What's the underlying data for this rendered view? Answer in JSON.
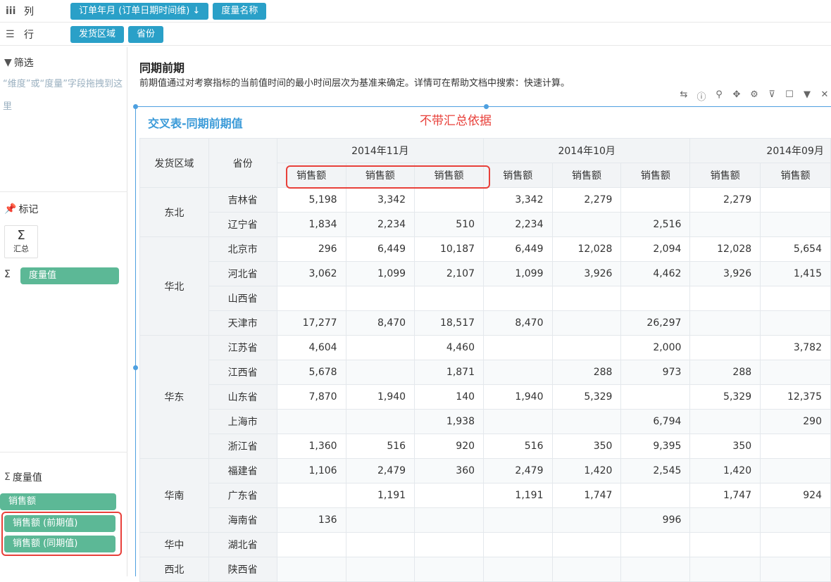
{
  "shelves": {
    "columns": {
      "label": "列",
      "pills": [
        "订单年月 (订单日期时间维) ↓",
        "度量名称"
      ]
    },
    "rows": {
      "label": "行",
      "pills": [
        "发货区域",
        "省份"
      ]
    }
  },
  "left": {
    "filter_title": "筛选",
    "filter_hint": "“维度”或“度量”字段拖拽到这里",
    "marks_title": "标记",
    "sum_label": "汇总",
    "measure_value_pill": "度量值",
    "measures_title": "度量值",
    "measures": [
      "销售额",
      "销售额 (前期值)",
      "销售额 (同期值)"
    ]
  },
  "main": {
    "title": "同期前期",
    "description": "前期值通过对考察指标的当前值时间的最小时间层次为基准来确定。详情可在帮助文档中搜索：快速计算。",
    "chart_title": "交叉表-同期前期值",
    "annotation": "不带汇总依据"
  },
  "table": {
    "row_headers": [
      "发货区域",
      "省份"
    ],
    "months": [
      "2014年11月",
      "2014年10月",
      "2014年09月"
    ],
    "measure_header": "销售额",
    "groups": [
      {
        "region": "东北",
        "rows": [
          {
            "province": "吉林省",
            "values": [
              "5,198",
              "3,342",
              "",
              "3,342",
              "2,279",
              "",
              "2,279",
              ""
            ]
          },
          {
            "province": "辽宁省",
            "values": [
              "1,834",
              "2,234",
              "510",
              "2,234",
              "",
              "2,516",
              "",
              ""
            ]
          }
        ]
      },
      {
        "region": "华北",
        "rows": [
          {
            "province": "北京市",
            "values": [
              "296",
              "6,449",
              "10,187",
              "6,449",
              "12,028",
              "2,094",
              "12,028",
              "5,654"
            ]
          },
          {
            "province": "河北省",
            "values": [
              "3,062",
              "1,099",
              "2,107",
              "1,099",
              "3,926",
              "4,462",
              "3,926",
              "1,415"
            ]
          },
          {
            "province": "山西省",
            "values": [
              "",
              "",
              "",
              "",
              "",
              "",
              "",
              ""
            ]
          },
          {
            "province": "天津市",
            "values": [
              "17,277",
              "8,470",
              "18,517",
              "8,470",
              "",
              "26,297",
              "",
              ""
            ]
          }
        ]
      },
      {
        "region": "华东",
        "rows": [
          {
            "province": "江苏省",
            "values": [
              "4,604",
              "",
              "4,460",
              "",
              "",
              "2,000",
              "",
              "3,782"
            ]
          },
          {
            "province": "江西省",
            "values": [
              "5,678",
              "",
              "1,871",
              "",
              "288",
              "973",
              "288",
              ""
            ]
          },
          {
            "province": "山东省",
            "values": [
              "7,870",
              "1,940",
              "140",
              "1,940",
              "5,329",
              "",
              "5,329",
              "12,375"
            ]
          },
          {
            "province": "上海市",
            "values": [
              "",
              "",
              "1,938",
              "",
              "",
              "6,794",
              "",
              "290"
            ]
          },
          {
            "province": "浙江省",
            "values": [
              "1,360",
              "516",
              "920",
              "516",
              "350",
              "9,395",
              "350",
              ""
            ]
          }
        ]
      },
      {
        "region": "华南",
        "rows": [
          {
            "province": "福建省",
            "values": [
              "1,106",
              "2,479",
              "360",
              "2,479",
              "1,420",
              "2,545",
              "1,420",
              ""
            ]
          },
          {
            "province": "广东省",
            "values": [
              "",
              "1,191",
              "",
              "1,191",
              "1,747",
              "",
              "1,747",
              "924"
            ]
          },
          {
            "province": "海南省",
            "values": [
              "136",
              "",
              "",
              "",
              "",
              "996",
              "",
              ""
            ]
          }
        ]
      },
      {
        "region": "华中",
        "rows": [
          {
            "province": "湖北省",
            "values": [
              "",
              "",
              "",
              "",
              "",
              "",
              "",
              ""
            ]
          }
        ]
      },
      {
        "region": "西北",
        "rows": [
          {
            "province": "陕西省",
            "values": [
              "",
              "",
              "",
              "",
              "",
              "",
              "",
              ""
            ]
          }
        ]
      }
    ]
  },
  "colors": {
    "pill_blue": "#2aa0c8",
    "pill_green": "#5cb896",
    "highlight_red": "#e8403a",
    "selection_blue": "#4ea0e0"
  }
}
